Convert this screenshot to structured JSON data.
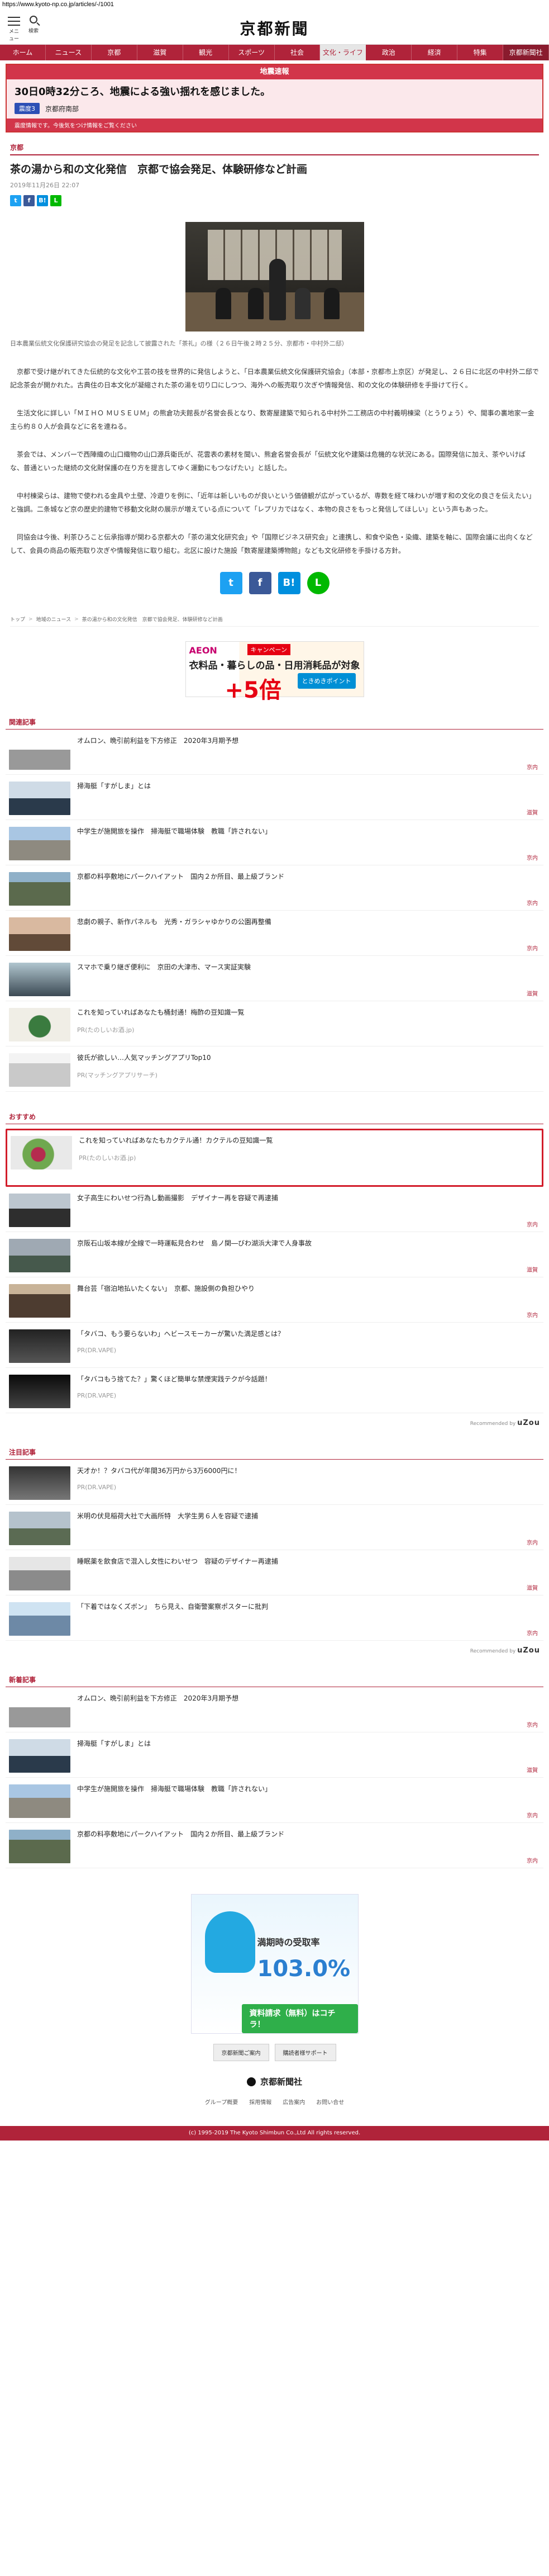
{
  "url": "https://www.kyoto-np.co.jp/articles/-/1001",
  "header": {
    "menu_label": "メニュー",
    "search_label": "検索",
    "logo": "京都新聞"
  },
  "nav": [
    "ホーム",
    "ニュース",
    "京都",
    "滋賀",
    "観光",
    "スポーツ",
    "社会",
    "文化・ライフ",
    "政治",
    "経済",
    "特集",
    "京都新聞社"
  ],
  "breaking": {
    "title": "地震速報",
    "headline": "30日0時32分ころ、地震による強い揺れを感じました。",
    "badge": "震度3",
    "area": "京都府南部",
    "footer": "震度情報です。今後気をつけ情報をご覧ください"
  },
  "article": {
    "category": "京都",
    "title": "茶の湯から和の文化発信　京都で協会発足、体験研修など計画",
    "date": "2019年11月26日 22:07",
    "caption": "日本農業伝統文化保護研究協会の発足を記念して披露された「茶礼」の様（２６日午後２時２５分、京都市・中村外二邸）",
    "paragraphs": [
      "京都で受け継がれてきた伝統的な文化や工芸の技を世界的に発信しようと、「日本農業伝統文化保護研究協会」（本部・京都市上京区）が発足し、２６日に北区の中村外二邸で記念茶会が開かれた。古典住の日本文化が凝縮された茶の湯を切り口にしつつ、海外への販売取り次ぎや情報発信、和の文化の体験研修を手掛けて行く。",
      "生活文化に詳しい「ＭＩＨＯ ＭＵＳＥＵＭ」の熊倉功夫館長が名誉会長となり、数寄屋建築で知られる中村外二工務店の中村義明棟梁（とうりょう）や、聞事の裏地家一金主ら約８０人が会員などに名を連ねる。",
      "茶会では、メンバーで西陣織の山口織物の山口源兵衛氏が、花雲表の素材を聞い、熊倉名誉会長が「伝統文化や建築は危機的な状況にある。国際発信に加え、茶やいけばな、普通といった継続の文化財保護の在り方を提言してゆく運動にもつなげたい」と話した。",
      "中村棟梁らは、建物で使われる金具や土壁、冷遊りを例に、「近年は新しいものが良いという価値観が広がっているが、専数を経て味わいが増す和の文化の良さを伝えたい」と強調。二条城など京の歴史的建物で移動文化財の展示が増えている点について「レプリカではなく、本物の良さをもっと発信してほしい」という声もあった。",
      "同協会は今後、利茶ひろこと伝承指導が関わる京都大の「茶の湯文化研究会」や「国際ビジネス研究会」と連携し、和食や染色・染織、建築を軸に、国際会議に出向くなどして、会員の商品の販売取り次ぎや情報発信に取り組む。北区に設けた施設「数寄屋建築博物館」なども文化研修を手掛ける方針。"
    ],
    "share": [
      "t",
      "f",
      "B!",
      "LINE"
    ]
  },
  "breadcrumb": [
    "トップ",
    "地域のニュース",
    "茶の湯から和の文化発信　京都で協会発足、体験研修など計画"
  ],
  "ad_top": {
    "brand": "AEON",
    "badge": "キャンペーン",
    "line1": "衣料品・暮らしの品・日用消耗品が対象",
    "line2": "+5倍",
    "pill": "ときめきポイント"
  },
  "sections": {
    "related": {
      "title": "関連記事",
      "items": [
        {
          "title": "オムロン、晩引前利益を下方修正　2020年3月期予想",
          "cat": "京内"
        },
        {
          "title": "掃海艇「すがしま」とは",
          "cat": "滋賀"
        },
        {
          "title": "中学生が施開旅を操作　掃海艇で職場体験　教職「許されない」",
          "cat": "京内"
        },
        {
          "title": "京都の料亭敷地にパークハイアット　国内２か所目、最上級ブランド",
          "cat": "京内"
        },
        {
          "title": "悲劇の親子、新作パネルも　光秀・ガラシャゆかりの公園再整備",
          "cat": "京内"
        },
        {
          "title": "スマホで乗り継ぎ便利に　京田の大津市、マース実証実験",
          "cat": "滋賀"
        },
        {
          "title": "これを知っていればあなたも桶封通！梅酢の豆知識一覧",
          "pr": "PR(たのしいお酒.jp)"
        },
        {
          "title": "彼氏が欲しい…人気マッチングアプリTop10",
          "pr": "PR(マッチングアプリサーチ)"
        }
      ]
    },
    "recommend": {
      "title": "おすすめ",
      "highlight": {
        "title": "これを知っていればあなたもカクテル通！カクテルの豆知識一覧",
        "pr": "PR(たのしいお酒.jp)"
      },
      "items": [
        {
          "title": "女子高生にわいせつ行為し動画撮影　デザイナー再を容疑で再逮捕",
          "cat": "京内"
        },
        {
          "title": "京阪石山坂本線が全線で一時運転見合わせ　島ノ関―びわ湖浜大津で人身事故",
          "cat": "滋賀"
        },
        {
          "title": "舞台芸「宿泊地払いたくない」　京都、施設側の負担ひやり",
          "cat": "京内"
        },
        {
          "title": "「タバコ、もう要らないわ」ヘビースモーカーが驚いた満足感とは？",
          "pr": "PR(DR.VAPE)"
        },
        {
          "title": "「タバコもう捨てた？」驚くほど簡単な禁煙実践テクが今話題！",
          "pr": "PR(DR.VAPE)"
        }
      ],
      "recommended_by": "Recommended by",
      "brand": "uZou"
    },
    "attention": {
      "title": "注目記事",
      "items": [
        {
          "title": "天才か！？タバコ代が年間36万円から3万6000円に！",
          "pr": "PR(DR.VAPE)"
        },
        {
          "title": "米明の伏見稲荷大社で大画所特　大学生男６人を容疑で逮捕",
          "cat": "京内"
        },
        {
          "title": "睡眠薬を飲食店で混入し女性にわいせつ　容疑のデザイナー再逮捕",
          "cat": "滋賀"
        },
        {
          "title": "「下着ではなくズボン」　ちら見え、自衛警案察ポスターに批判",
          "cat": "京内"
        }
      ],
      "recommended_by": "Recommended by",
      "brand": "uZou"
    },
    "latest": {
      "title": "新着記事",
      "items": [
        {
          "title": "オムロン、晩引前利益を下方修正　2020年3月期予想",
          "cat": "京内"
        },
        {
          "title": "掃海艇「すがしま」とは",
          "cat": "滋賀"
        },
        {
          "title": "中学生が施開旅を操作　掃海艇で職場体験　教職「許されない」",
          "cat": "京内"
        },
        {
          "title": "京都の料亭敷地にパークハイアット　国内２か所目、最上級ブランド",
          "cat": "京内"
        }
      ]
    }
  },
  "ad_bottom": {
    "label": "満期時の受取率",
    "big": "103.0%",
    "btn": "資料請求（無料）はコチラ！"
  },
  "footer_buttons": [
    "京都新聞ご案内",
    "購読者様サポート"
  ],
  "footer_logo": "京都新聞社",
  "footer_links": [
    "グループ概要",
    "採用情報",
    "広告案内",
    "お問い合せ"
  ],
  "copyright": "(c) 1995-2019 The Kyoto Shimbun Co.,Ltd All rights reserved."
}
